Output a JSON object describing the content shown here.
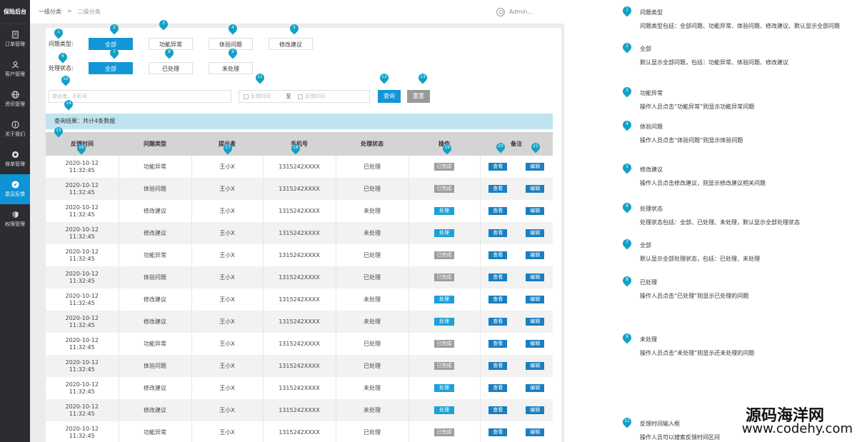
{
  "app": {
    "title": "保险后台"
  },
  "sidebar": {
    "items": [
      {
        "label": "订单管理",
        "icon": "file-icon",
        "active": false
      },
      {
        "label": "客户管理",
        "icon": "users-icon",
        "active": false
      },
      {
        "label": "资讯管理",
        "icon": "globe-icon",
        "active": false
      },
      {
        "label": "关于我们",
        "icon": "info-icon",
        "active": false
      },
      {
        "label": "保单管理",
        "icon": "circle-icon",
        "active": false
      },
      {
        "label": "意见反馈",
        "icon": "compass-icon",
        "active": true
      },
      {
        "label": "权限管理",
        "icon": "shield-icon",
        "active": false
      }
    ]
  },
  "breadcrumb": {
    "level1": "一级分类",
    "sep": ">",
    "level2": "二级分类"
  },
  "user": {
    "name": "Admin..."
  },
  "filters": {
    "type_label": "问题类型:",
    "type_options": [
      "全部",
      "功能异常",
      "体验问题",
      "修改建议"
    ],
    "status_label": "处理状态:",
    "status_options": [
      "全部",
      "已处理",
      "未处理"
    ]
  },
  "search": {
    "placeholder": "提出者、手机号",
    "date_start": "反馈时间",
    "date_to": "至",
    "date_end": "反馈时间",
    "query_btn": "查询",
    "reset_btn": "重置"
  },
  "result": {
    "text": "查询结果：共计4条数据"
  },
  "table": {
    "headers": [
      "反馈时间",
      "问题类型",
      "提出者",
      "手机号",
      "处理状态",
      "操作",
      "备注"
    ],
    "view_label": "查看",
    "edit_label": "编辑",
    "done_label": "已完成",
    "process_label": "处理",
    "rows": [
      {
        "date": "2020-10-12",
        "time": "11:32:45",
        "type": "功能异常",
        "user": "王小X",
        "phone": "1315242XXXX",
        "status": "已处理",
        "action": "已完成"
      },
      {
        "date": "2020-10-12",
        "time": "11:32:45",
        "type": "体验问题",
        "user": "王小X",
        "phone": "1315242XXXX",
        "status": "已处理",
        "action": "已完成"
      },
      {
        "date": "2020-10-12",
        "time": "11:32:45",
        "type": "修改建议",
        "user": "王小X",
        "phone": "1315242XXXX",
        "status": "未处理",
        "action": "处理"
      },
      {
        "date": "2020-10-12",
        "time": "11:32:45",
        "type": "修改建议",
        "user": "王小X",
        "phone": "1315242XXXX",
        "status": "未处理",
        "action": "处理"
      },
      {
        "date": "2020-10-12",
        "time": "11:32:45",
        "type": "功能异常",
        "user": "王小X",
        "phone": "1315242XXXX",
        "status": "已处理",
        "action": "已完成"
      },
      {
        "date": "2020-10-12",
        "time": "11:32:45",
        "type": "体验问题",
        "user": "王小X",
        "phone": "1315242XXXX",
        "status": "已处理",
        "action": "已完成"
      },
      {
        "date": "2020-10-12",
        "time": "11:32:45",
        "type": "修改建议",
        "user": "王小X",
        "phone": "1315242XXXX",
        "status": "未处理",
        "action": "处理"
      },
      {
        "date": "2020-10-12",
        "time": "11:32:45",
        "type": "修改建议",
        "user": "王小X",
        "phone": "1315242XXXX",
        "status": "未处理",
        "action": "处理"
      },
      {
        "date": "2020-10-12",
        "time": "11:32:45",
        "type": "功能异常",
        "user": "王小X",
        "phone": "1315242XXXX",
        "status": "已处理",
        "action": "已完成"
      },
      {
        "date": "2020-10-12",
        "time": "11:32:45",
        "type": "体验问题",
        "user": "王小X",
        "phone": "1315242XXXX",
        "status": "已处理",
        "action": "已完成"
      },
      {
        "date": "2020-10-12",
        "time": "11:32:45",
        "type": "修改建议",
        "user": "王小X",
        "phone": "1315242XXXX",
        "status": "未处理",
        "action": "处理"
      },
      {
        "date": "2020-10-12",
        "time": "11:32:45",
        "type": "修改建议",
        "user": "王小X",
        "phone": "1315242XXXX",
        "status": "未处理",
        "action": "处理"
      },
      {
        "date": "2020-10-12",
        "time": "11:32:45",
        "type": "功能异常",
        "user": "王小X",
        "phone": "1315242XXXX",
        "status": "已处理",
        "action": "已完成"
      }
    ]
  },
  "markers": [
    "1",
    "2",
    "3",
    "4",
    "5",
    "6",
    "7",
    "8",
    "9",
    "10",
    "11",
    "12",
    "13",
    "14",
    "15",
    "16",
    "17",
    "18",
    "19",
    "20",
    "21"
  ],
  "notes": [
    {
      "num": "1",
      "title": "问题类型",
      "desc": "问题类型包括：全部问题、功能异常、体验问题、修改建议、默认显示全部问题"
    },
    {
      "num": "2",
      "title": "全部",
      "desc": "默认显示全部问题，包括：功能异常、体验问题、修改建议"
    },
    {
      "num": "3",
      "title": "功能异常",
      "desc": "操作人员点击“功能异常”则显示功能异常问题"
    },
    {
      "num": "4",
      "title": "体验问题",
      "desc": "操作人员点击“体验问题”则显示体验问题"
    },
    {
      "num": "5",
      "title": "修改建议",
      "desc": "操作人员点击修改建议，则显示修改建议相关问题"
    },
    {
      "num": "6",
      "title": "处理状态",
      "desc": "处理状态包括：全部、已处理、未处理，默认显示全部处理状态"
    },
    {
      "num": "7",
      "title": "全部",
      "desc": "默认显示全部处理状态，包括：已处理、未处理"
    },
    {
      "num": "8",
      "title": "已处理",
      "desc": "操作人员点击“已处理”则显示已处理的问题"
    },
    {
      "num": "9",
      "title": "未处理",
      "desc": "操作人员点击“未处理”则显示还未处理的问题"
    },
    {
      "num": "11",
      "title": "反馈时间输入框",
      "desc": "操作人员可以搜索反馈时间区间"
    }
  ],
  "watermark": {
    "line1": "源码海洋网",
    "line2": "www.codehy.com"
  }
}
